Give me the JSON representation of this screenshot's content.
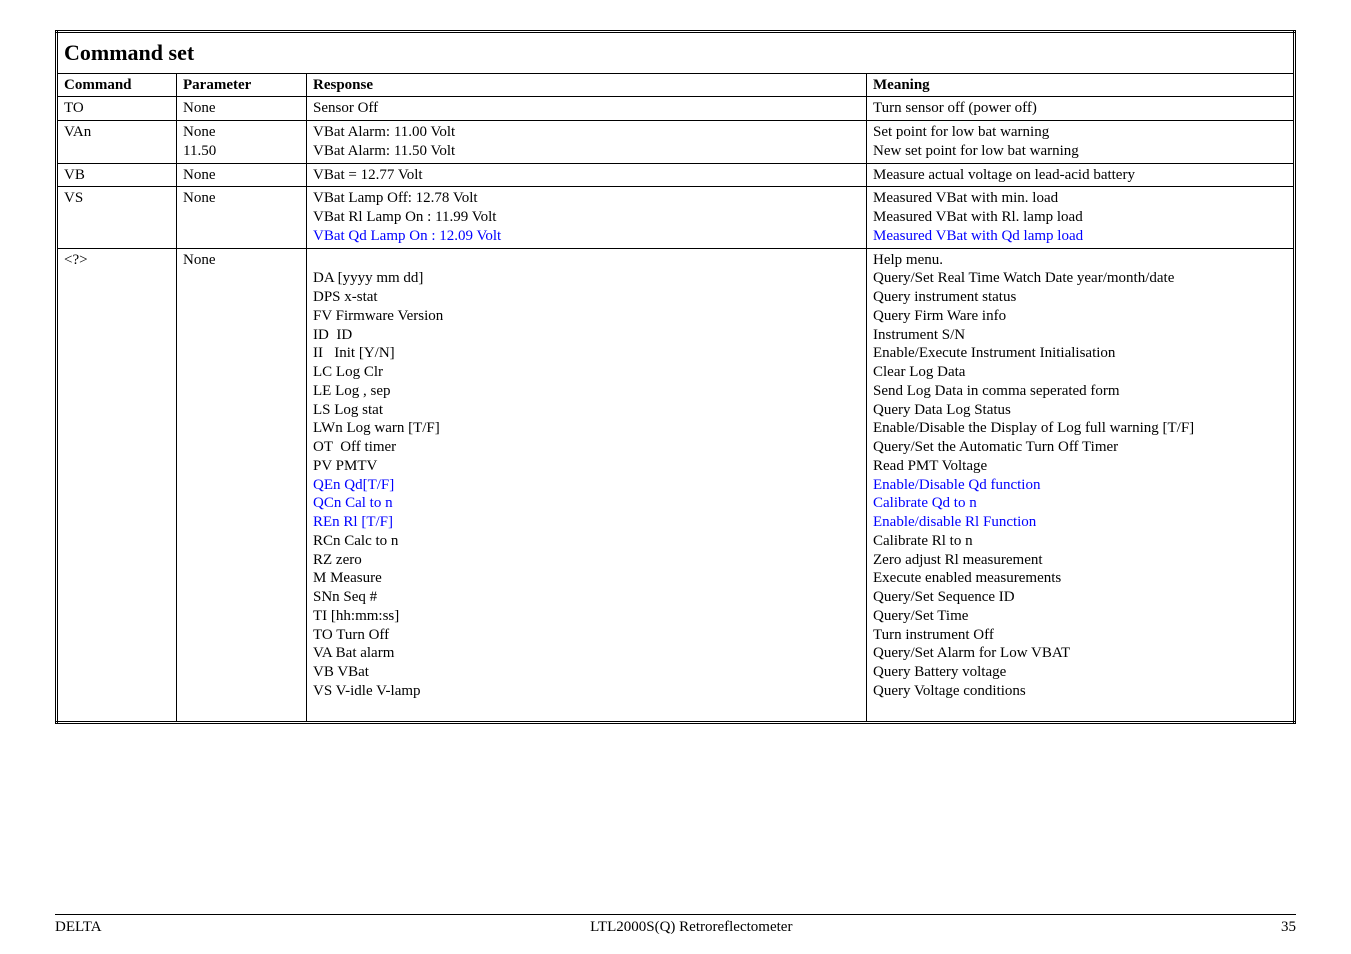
{
  "title": "Command set",
  "headers": {
    "command": "Command",
    "parameter": "Parameter",
    "response": "Response",
    "meaning": "Meaning"
  },
  "rows": [
    {
      "command": "TO",
      "parameter": "None",
      "response": [
        {
          "t": "Sensor Off"
        }
      ],
      "meaning": [
        {
          "t": "Turn sensor off (power off)"
        }
      ]
    },
    {
      "command": "VAn",
      "parameter_lines": [
        "None",
        "11.50"
      ],
      "response": [
        {
          "t": "VBat Alarm: 11.00 Volt"
        },
        {
          "t": "VBat Alarm: 11.50 Volt"
        }
      ],
      "meaning": [
        {
          "t": "Set point for low bat warning"
        },
        {
          "t": "New set point for low bat warning"
        }
      ]
    },
    {
      "command": "VB",
      "parameter": "None",
      "response": [
        {
          "t": "VBat = 12.77 Volt"
        }
      ],
      "meaning": [
        {
          "t": "Measure actual voltage on lead-acid battery"
        }
      ]
    },
    {
      "command": "VS",
      "parameter": "None",
      "response": [
        {
          "t": "VBat Lamp Off: 12.78 Volt"
        },
        {
          "t": "VBat Rl Lamp On : 11.99 Volt"
        },
        {
          "t": "VBat Qd Lamp On : 12.09 Volt",
          "c": "blue"
        }
      ],
      "meaning": [
        {
          "t": "Measured VBat with min. load"
        },
        {
          "t": "Measured VBat with Rl. lamp load"
        },
        {
          "t": "Measured VBat with Qd lamp load",
          "c": "blue"
        }
      ]
    },
    {
      "command": "<?>",
      "parameter": "None",
      "response": [
        {
          "t": ""
        },
        {
          "t": "DA [yyyy mm dd]"
        },
        {
          "t": "DPS x-stat"
        },
        {
          "t": "FV Firmware Version"
        },
        {
          "t": "ID  ID"
        },
        {
          "t": "II   Init [Y/N]"
        },
        {
          "t": "LC Log Clr"
        },
        {
          "t": "LE Log , sep"
        },
        {
          "t": "LS Log stat"
        },
        {
          "t": "LWn Log warn [T/F]"
        },
        {
          "t": "OT  Off timer"
        },
        {
          "t": "PV PMTV"
        },
        {
          "t": "QEn Qd[T/F]",
          "c": "blue"
        },
        {
          "t": "QCn Cal to n",
          "c": "blue"
        },
        {
          "t": "REn Rl [T/F]",
          "c": "blue"
        },
        {
          "t": "RCn Calc to n"
        },
        {
          "t": "RZ zero"
        },
        {
          "t": "M Measure"
        },
        {
          "t": "SNn Seq #"
        },
        {
          "t": "TI [hh:mm:ss]"
        },
        {
          "t": "TO Turn Off"
        },
        {
          "t": "VA Bat alarm"
        },
        {
          "t": "VB VBat"
        },
        {
          "t": "VS V-idle V-lamp"
        },
        {
          "t": ""
        }
      ],
      "meaning": [
        {
          "t": "Help menu."
        },
        {
          "t": "Query/Set Real Time Watch Date year/month/date"
        },
        {
          "t": "Query instrument status"
        },
        {
          "t": "Query Firm Ware info"
        },
        {
          "t": "Instrument S/N"
        },
        {
          "t": "Enable/Execute Instrument Initialisation"
        },
        {
          "t": "Clear Log Data"
        },
        {
          "t": "Send Log Data in comma seperated form"
        },
        {
          "t": "Query Data Log Status"
        },
        {
          "t": "Enable/Disable the Display of Log full warning [T/F]"
        },
        {
          "t": "Query/Set the Automatic Turn Off Timer"
        },
        {
          "t": "Read PMT Voltage"
        },
        {
          "t": "Enable/Disable Qd function",
          "c": "blue"
        },
        {
          "t": "Calibrate Qd to n",
          "c": "blue"
        },
        {
          "t": "Enable/disable Rl Function",
          "c": "blue"
        },
        {
          "t": "Calibrate Rl to n"
        },
        {
          "t": "Zero adjust Rl measurement"
        },
        {
          "t": "Execute enabled measurements"
        },
        {
          "t": "Query/Set Sequence ID"
        },
        {
          "t": "Query/Set Time"
        },
        {
          "t": "Turn instrument Off"
        },
        {
          "t": "Query/Set Alarm for Low VBAT"
        },
        {
          "t": "Query Battery voltage"
        },
        {
          "t": "Query Voltage conditions"
        },
        {
          "t": ""
        }
      ]
    }
  ],
  "footer": {
    "left": "DELTA",
    "center": "LTL2000S(Q) Retroreflectometer",
    "right": "35"
  }
}
